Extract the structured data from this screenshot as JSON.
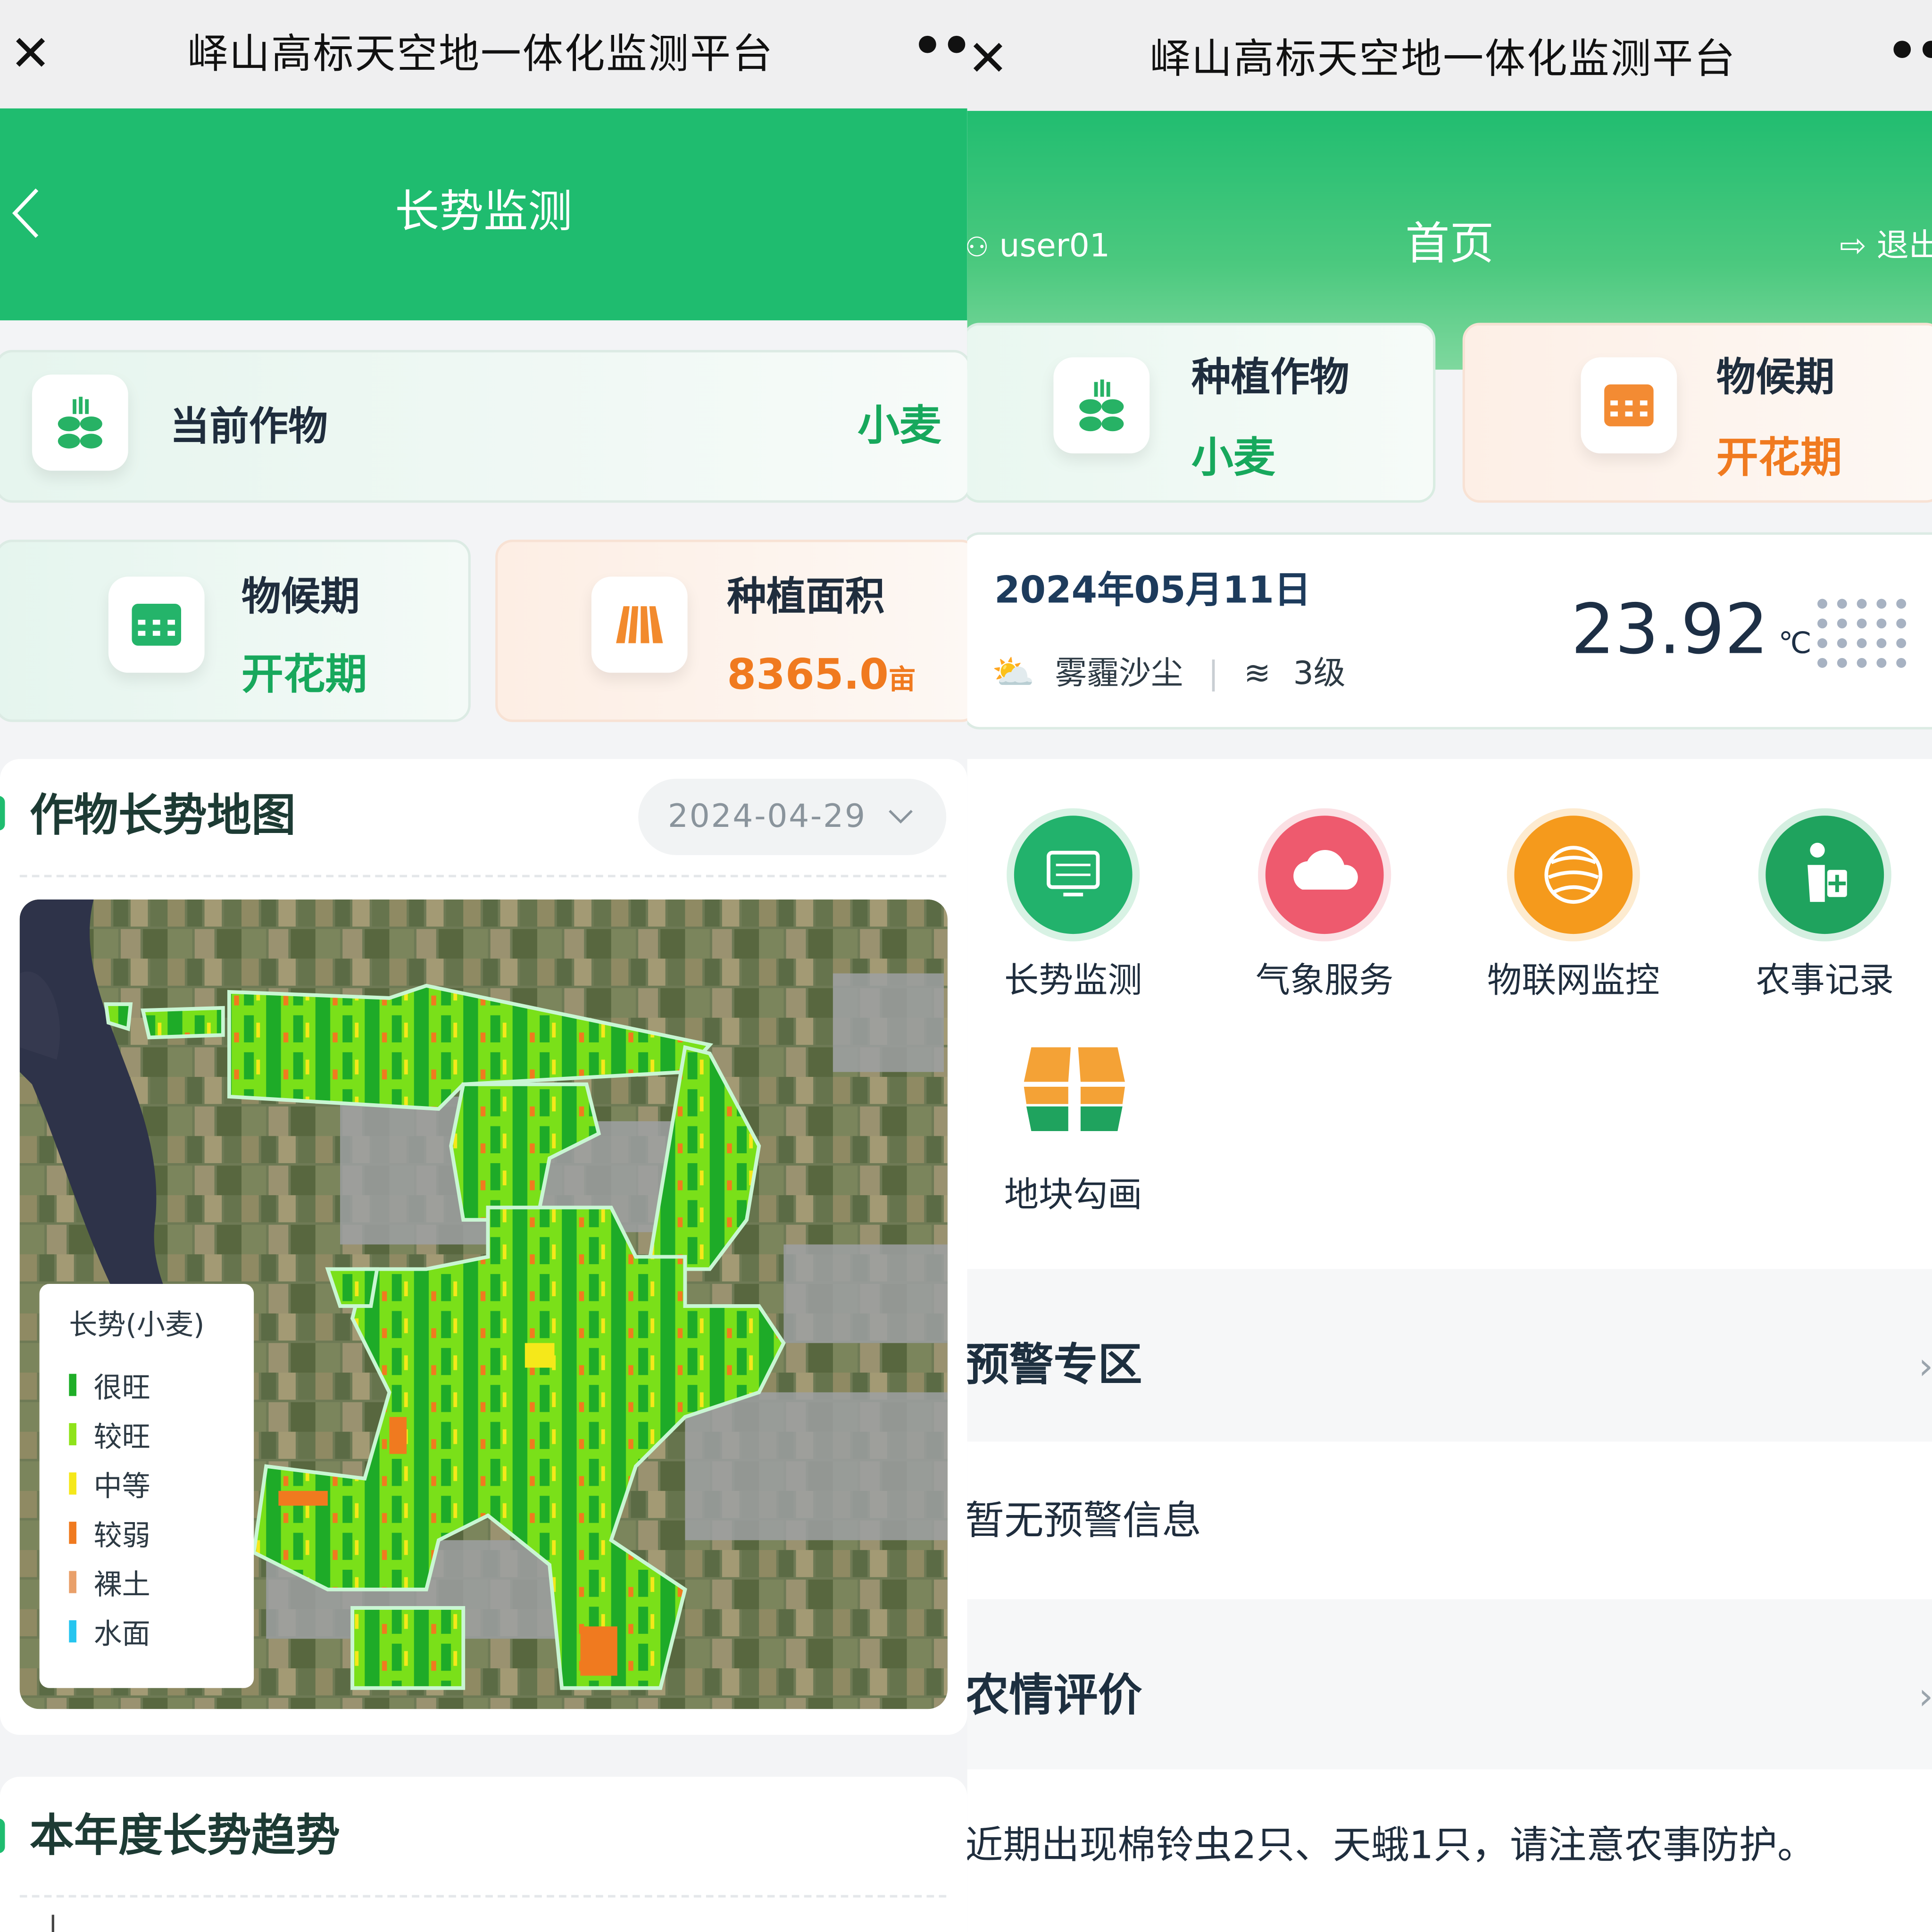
{
  "app_title": "峄山高标天空地一体化监测平台",
  "left": {
    "header": {
      "title": "长势监测"
    },
    "crop_card": {
      "label": "当前作物",
      "value": "小麦"
    },
    "phenology_card": {
      "label": "物候期",
      "value": "开花期"
    },
    "area_card": {
      "label": "种植面积",
      "value": "8365.0",
      "unit": "亩"
    },
    "map_section": {
      "title": "作物长势地图",
      "date": "2024-04-29"
    },
    "legend": {
      "title": "长势(小麦)",
      "items": [
        {
          "label": "很旺",
          "color": "#1fae28"
        },
        {
          "label": "较旺",
          "color": "#8fe31a"
        },
        {
          "label": "中等",
          "color": "#f5e81a"
        },
        {
          "label": "较弱",
          "color": "#f07a1f"
        },
        {
          "label": "裸土",
          "color": "#e9a06a"
        },
        {
          "label": "水面",
          "color": "#26c5ef"
        }
      ]
    },
    "trend_section": {
      "title": "本年度长势趋势"
    }
  },
  "right": {
    "header": {
      "user": "user01",
      "title": "首页",
      "logout": "退出"
    },
    "crop_card": {
      "label": "种植作物",
      "value": "小麦"
    },
    "phenology_card": {
      "label": "物候期",
      "value": "开花期"
    },
    "weather": {
      "date": "2024年05月11日",
      "condition": "雾霾沙尘",
      "wind": "3级",
      "temperature": "23.92",
      "temp_unit": "℃"
    },
    "menu": [
      {
        "label": "长势监测",
        "icon": "monitor-icon",
        "color": "#22b26c"
      },
      {
        "label": "气象服务",
        "icon": "cloud-icon",
        "color": "#ee5a6e"
      },
      {
        "label": "物联网监控",
        "icon": "globe-icon",
        "color": "#f59a1c"
      },
      {
        "label": "农事记录",
        "icon": "farmer-icon",
        "color": "#1fa35e"
      },
      {
        "label": "地块勾画",
        "icon": "field-plot-icon",
        "color": "#f4a236"
      }
    ],
    "warning": {
      "title": "预警专区",
      "message": "暂无预警信息"
    },
    "evaluation": {
      "title": "农情评价",
      "message": "近期出现棉铃虫2只、天蛾1只，请注意农事防护。"
    }
  }
}
